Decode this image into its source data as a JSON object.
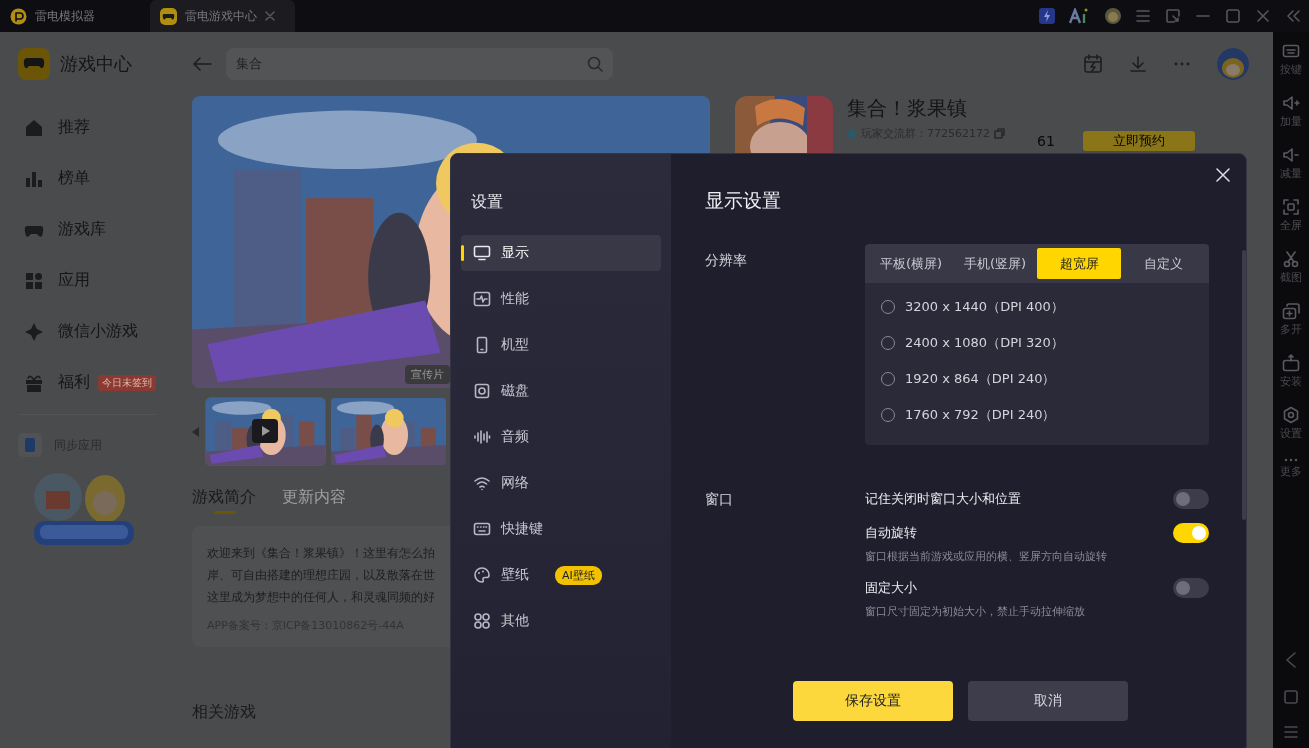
{
  "titlebar": {
    "tabs": [
      {
        "label": "雷电模拟器",
        "selected": false
      },
      {
        "label": "雷电游戏中心",
        "selected": true
      }
    ]
  },
  "nav": {
    "title": "游戏中心",
    "items": [
      {
        "label": "推荐"
      },
      {
        "label": "榜单"
      },
      {
        "label": "游戏库"
      },
      {
        "label": "应用"
      },
      {
        "label": "微信小游戏"
      },
      {
        "label": "福利",
        "badge": "今日未签到"
      }
    ],
    "sync": "同步应用"
  },
  "search": {
    "value": "集合"
  },
  "banner": {
    "tag": "宣传片"
  },
  "game": {
    "title": "集合！浆果镇",
    "group": "玩家交流群：772562172",
    "count": "61",
    "button": "立即预约"
  },
  "tabs": [
    {
      "label": "游戏简介",
      "selected": true
    },
    {
      "label": "更新内容",
      "selected": false
    }
  ],
  "description": {
    "lines": [
      "欢迎来到《集合！浆果镇》！这里有怎么拍",
      "岸、可自由搭建的理想庄园，以及散落在世",
      "这里成为梦想中的任何人，和灵魂同频的好"
    ],
    "record": "APP备案号：京ICP备13010862号-44A"
  },
  "related": "相关游戏",
  "rail": [
    "按键",
    "加量",
    "减量",
    "全屏",
    "截图",
    "多开",
    "安装",
    "设置",
    "更多"
  ],
  "settings": {
    "title": "设置",
    "nav": [
      {
        "label": "显示",
        "selected": true
      },
      {
        "label": "性能",
        "selected": false
      },
      {
        "label": "机型",
        "selected": false
      },
      {
        "label": "磁盘",
        "selected": false
      },
      {
        "label": "音频",
        "selected": false
      },
      {
        "label": "网络",
        "selected": false
      },
      {
        "label": "快捷键",
        "selected": false
      },
      {
        "label": "壁纸",
        "selected": false,
        "badge": "AI壁纸"
      },
      {
        "label": "其他",
        "selected": false
      }
    ],
    "heading": "显示设置",
    "resolution": {
      "label": "分辨率",
      "modes": [
        {
          "label": "平板(横屏)",
          "selected": false
        },
        {
          "label": "手机(竖屏)",
          "selected": false
        },
        {
          "label": "超宽屏",
          "selected": true
        },
        {
          "label": "自定义",
          "selected": false
        }
      ],
      "options": [
        {
          "label": "3200 x 1440（DPI 400）",
          "selected": false
        },
        {
          "label": "2400 x 1080（DPI 320）",
          "selected": false
        },
        {
          "label": "1920 x 864（DPI 240）",
          "selected": false
        },
        {
          "label": "1760 x 792（DPI 240）",
          "selected": false
        }
      ]
    },
    "window": {
      "label": "窗口",
      "toggles": [
        {
          "label": "记住关闭时窗口大小和位置",
          "on": false
        },
        {
          "label": "自动旋转",
          "on": true,
          "hint": "窗口根据当前游戏或应用的横、竖屏方向自动旋转"
        },
        {
          "label": "固定大小",
          "on": false,
          "hint": "窗口尺寸固定为初始大小，禁止手动拉伸缩放"
        }
      ]
    },
    "buttons": [
      {
        "label": "保存设置",
        "kind": "primary"
      },
      {
        "label": "取消",
        "kind": "secondary"
      }
    ]
  }
}
